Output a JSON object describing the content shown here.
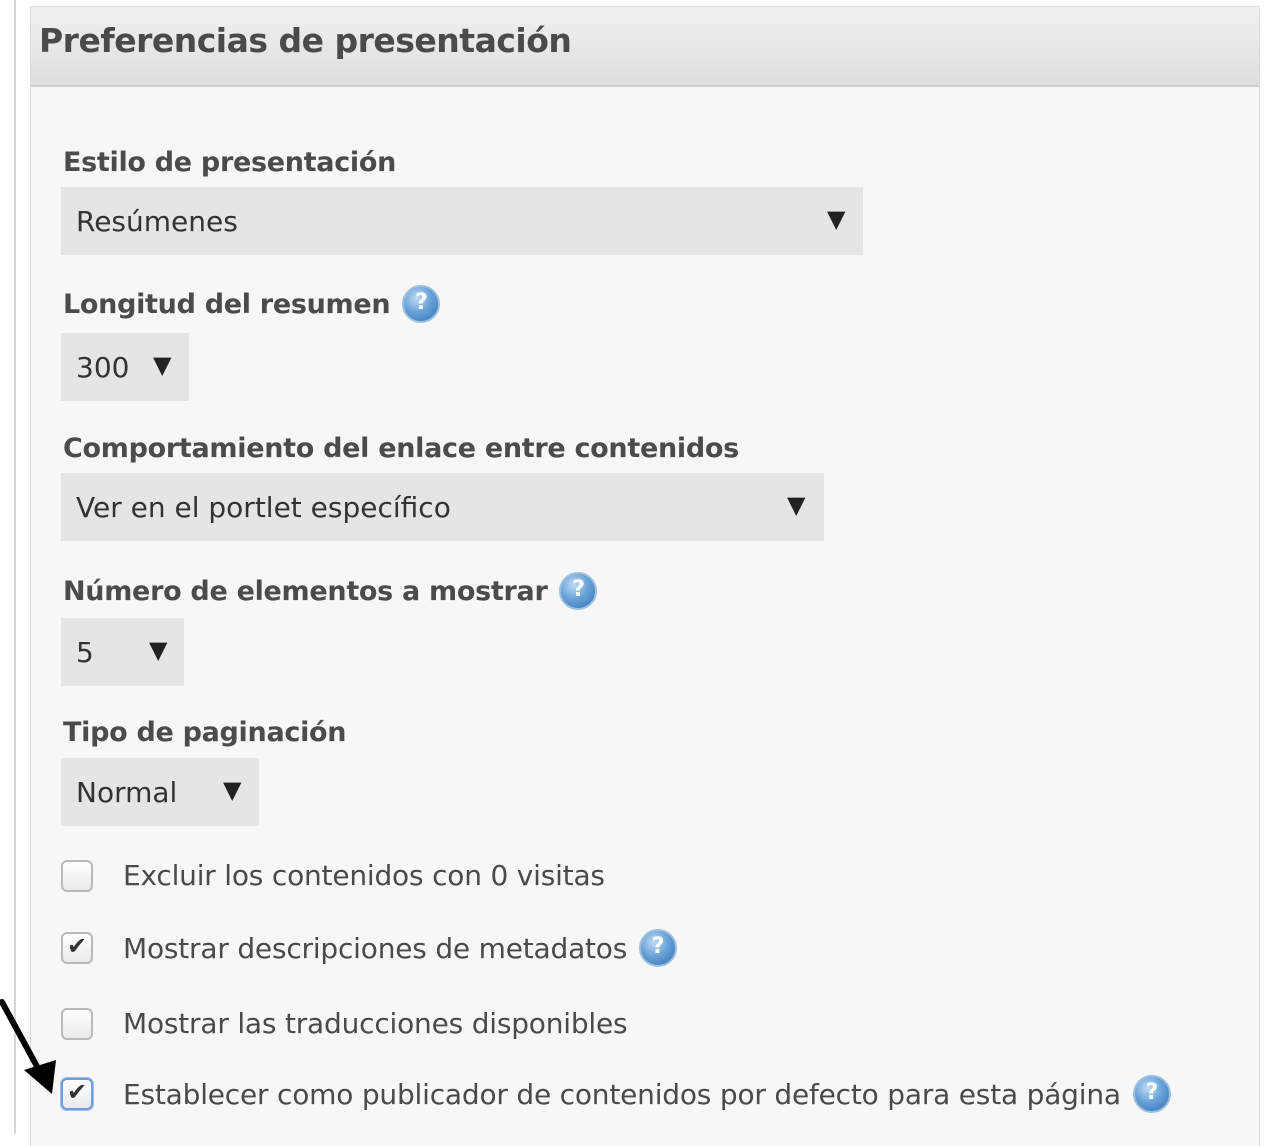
{
  "panel": {
    "title": "Preferencias de presentación"
  },
  "fields": {
    "display_style": {
      "label": "Estilo de presentación",
      "value": "Resúmenes"
    },
    "abstract_length": {
      "label": "Longitud del resumen",
      "value": "300"
    },
    "asset_link_behavior": {
      "label": "Comportamiento del enlace entre contenidos",
      "value": "Ver en el portlet específico"
    },
    "items_to_display": {
      "label": "Número de elementos a mostrar",
      "value": "5"
    },
    "pagination_type": {
      "label": "Tipo de paginación",
      "value": "Normal"
    }
  },
  "checkboxes": [
    {
      "label": "Excluir los contenidos con 0 visitas",
      "checked": false,
      "help": false
    },
    {
      "label": "Mostrar descripciones de metadatos",
      "checked": true,
      "help": true
    },
    {
      "label": "Mostrar las traducciones disponibles",
      "checked": false,
      "help": false
    },
    {
      "label": "Establecer como publicador de contenidos por defecto para esta página",
      "checked": true,
      "help": true
    }
  ],
  "icons": {
    "help": "help-icon",
    "dropdown": "caret-down-icon",
    "annotation": "arrow-pointer-icon"
  },
  "arrow_glyph": "▼",
  "colors": {
    "panel_bg": "#f7f7f7",
    "select_bg": "#e5e5e5",
    "help_blue": "#2e6fb2"
  }
}
